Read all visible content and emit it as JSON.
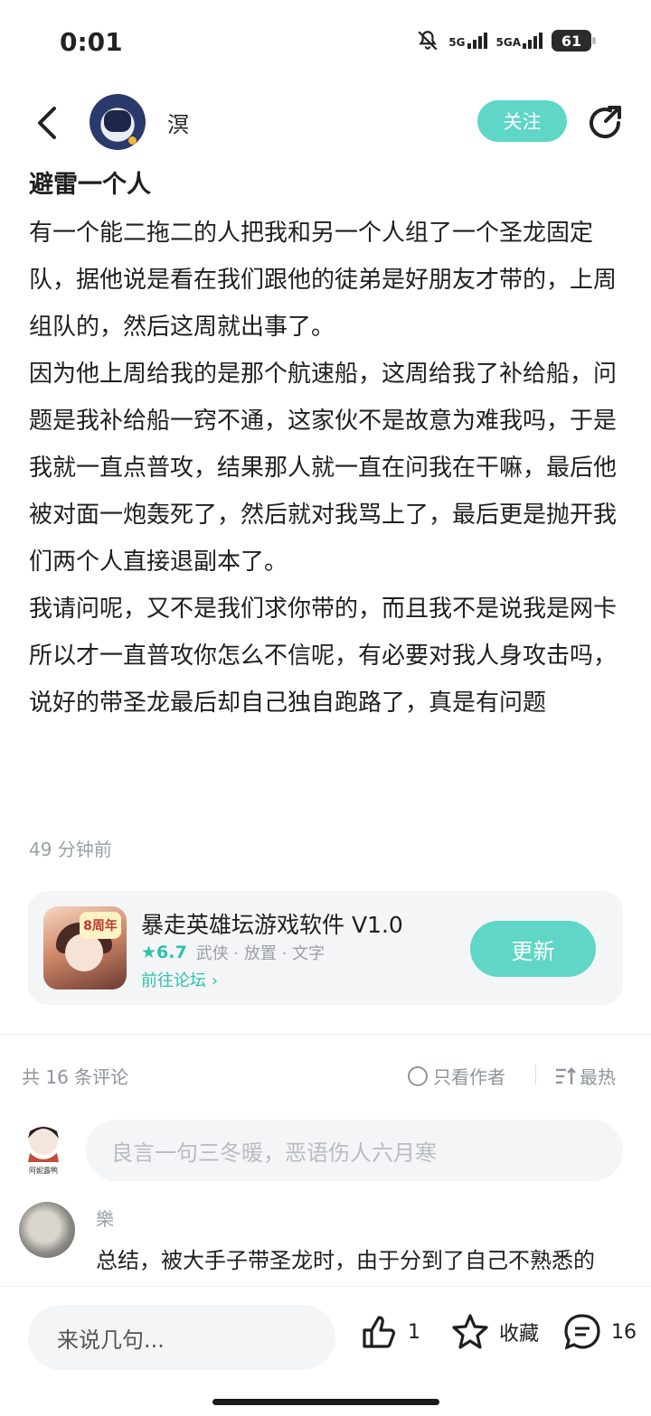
{
  "status": {
    "time": "0:01",
    "battery": "61",
    "net1": "5G",
    "net2": "5GA"
  },
  "header": {
    "username": "溟",
    "follow_label": "关注"
  },
  "post": {
    "title": "避雷一个人",
    "paragraphs": [
      "有一个能二拖二的人把我和另一个人组了一个圣龙固定队，据他说是看在我们跟他的徒弟是好朋友才带的，上周组队的，然后这周就出事了。",
      "因为他上周给我的是那个航速船，这周给我了补给船，问题是我补给船一窍不通，这家伙不是故意为难我吗，于是我就一直点普攻，结果那人就一直在问我在干嘛，最后他被对面一炮轰死了，然后就对我骂上了，最后更是抛开我们两个人直接退副本了。",
      "我请问呢，又不是我们求你带的，而且我不是说我是网卡所以才一直普攻你怎么不信呢，有必要对我人身攻击吗，说好的带圣龙最后却自己独自跑路了，真是有问题"
    ],
    "time": "49 分钟前"
  },
  "app_card": {
    "badge": "8周年",
    "name": "暴走英雄坛游戏软件 V1.0",
    "rating": "★6.7",
    "tags": "武侠 · 放置 · 文字",
    "link": "前往论坛 ›",
    "button": "更新"
  },
  "comments_bar": {
    "count": "共 16 条评论",
    "author_only": "只看作者",
    "sort": "最热"
  },
  "comment_input": {
    "placeholder": "良言一句三冬暖，恶语伤人六月寒",
    "me_label": "阿妮露鸭"
  },
  "comment": {
    "user": "樂",
    "text": "总结，被大手子带圣龙时，由于分到了自己不熟悉的船，心生怨恨，故意不放技能😅😅……真善"
  },
  "bottom": {
    "say": "来说几句...",
    "likes": "1",
    "fav": "收藏",
    "comments": "16"
  },
  "colors": {
    "accent": "#5fd6c6",
    "accent_text": "#2fbfae",
    "muted": "#9aa0a6"
  },
  "icons": [
    "back-arrow-icon",
    "share-icon",
    "like-icon",
    "star-icon",
    "comment-icon",
    "mute-bell-icon"
  ]
}
